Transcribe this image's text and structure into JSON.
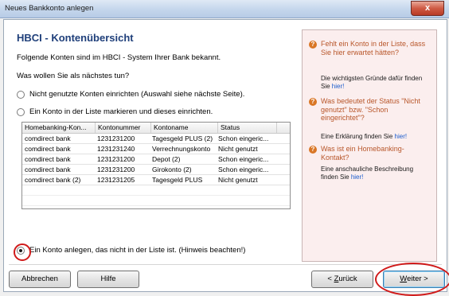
{
  "window": {
    "title": "Neues Bankkonto anlegen",
    "close_label": "x"
  },
  "main": {
    "heading": "HBCI - Kontenübersicht",
    "intro": "Folgende Konten sind im HBCI - System Ihrer Bank bekannt.",
    "question": "Was wollen Sie als nächstes tun?",
    "option1": "Nicht genutzte Konten einrichten (Auswahl siehe nächste Seite).",
    "option2": "Ein Konto in der Liste markieren und dieses einrichten.",
    "option3": "Ein Konto anlegen, das nicht in der Liste ist. (Hinweis beachten!)"
  },
  "table": {
    "headers": [
      "Homebanking-Kon...",
      "Kontonummer",
      "Kontoname",
      "Status"
    ],
    "rows": [
      [
        "comdirect bank",
        "1231231200",
        "Tagesgeld PLUS (2)",
        "Schon eingeric..."
      ],
      [
        "comdirect bank",
        "1231231240",
        "Verrechnungskonto",
        "Nicht genutzt"
      ],
      [
        "comdirect bank",
        "1231231200",
        "Depot (2)",
        "Schon eingeric..."
      ],
      [
        "comdirect bank",
        "1231231200",
        "Girokonto (2)",
        "Schon eingeric..."
      ],
      [
        "comdirect bank (2)",
        "1231231205",
        "Tagesgeld PLUS",
        "Nicht genutzt"
      ]
    ]
  },
  "help": {
    "items": [
      {
        "question": "Fehlt ein Konto in der Liste, dass Sie hier erwartet hätten?",
        "desc": "Die wichtigsten Gründe dafür finden Sie",
        "link": "hier!"
      },
      {
        "question": "Was bedeutet der Status \"Nicht genutzt\" bzw. \"Schon eingerichtet\"?",
        "desc": "Eine Erklärung finden Sie",
        "link": "hier!"
      },
      {
        "question": "Was ist ein Homebanking-Kontakt?",
        "desc": "Eine anschauliche Beschreibung finden Sie",
        "link": "hier!"
      }
    ]
  },
  "buttons": {
    "cancel": "Abbrechen",
    "help": "Hilfe",
    "back_mnemonic": "Z",
    "back_rest": "urück",
    "back_prefix": "< ",
    "next_mnemonic": "W",
    "next_rest": "eiter >"
  },
  "colors": {
    "heading": "#1f3f7a",
    "help_question": "#b8562a",
    "link": "#1a5ccd",
    "annotation": "#d01a1a"
  }
}
